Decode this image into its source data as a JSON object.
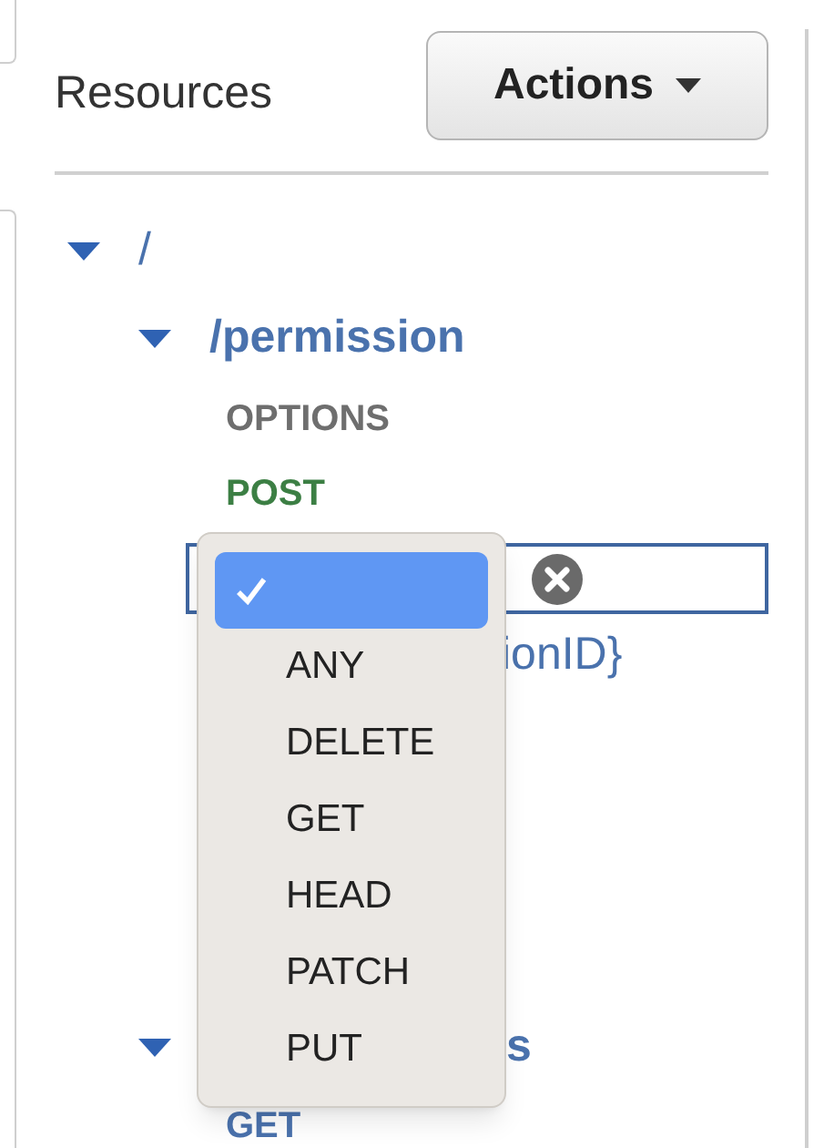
{
  "panel": {
    "title": "Resources",
    "actions_button": "Actions"
  },
  "tree": [
    {
      "label": "/",
      "expanded": true,
      "children": [
        {
          "label": "/permission",
          "expanded": true,
          "methods": [
            {
              "label": "OPTIONS",
              "color": "#6e6e6e"
            },
            {
              "label": "POST",
              "color": "#3c7f44"
            }
          ],
          "method_select": {
            "clear": true
          },
          "children": [
            {
              "label": "ionID}"
            }
          ]
        },
        {
          "label": "s",
          "expanded": true,
          "methods": [
            {
              "label": "GET",
              "color": "#4a72ad"
            }
          ]
        }
      ]
    }
  ],
  "method_menu": [
    {
      "selected": true
    },
    {
      "label": "ANY",
      "selected": false
    },
    {
      "label": "DELETE",
      "selected": false
    },
    {
      "label": "GET",
      "selected": false
    },
    {
      "label": "HEAD",
      "selected": false
    },
    {
      "label": "PATCH",
      "selected": false
    },
    {
      "label": "PUT",
      "selected": false
    }
  ]
}
